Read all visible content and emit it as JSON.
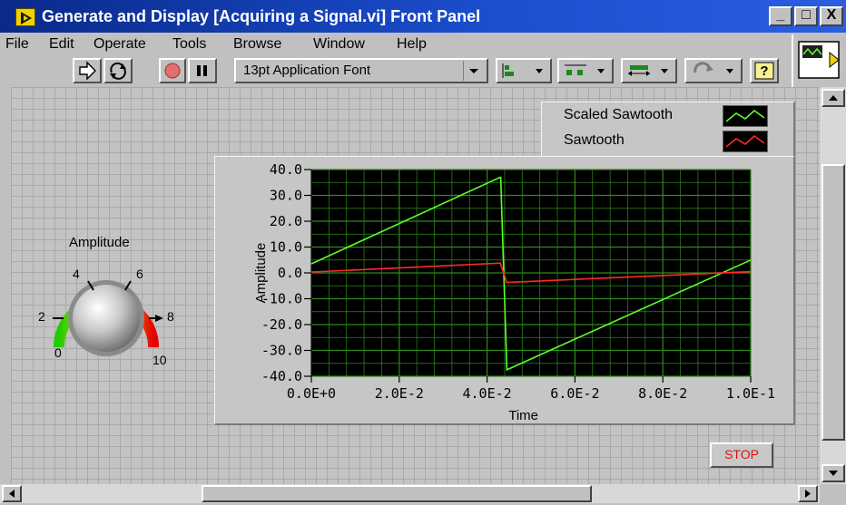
{
  "window": {
    "title": "Generate and Display [Acquiring a Signal.vi] Front Panel",
    "buttons": [
      "_",
      "□",
      "X"
    ]
  },
  "menu": [
    "File",
    "Edit",
    "Operate",
    "Tools",
    "Browse",
    "Window",
    "Help"
  ],
  "toolbar": {
    "font": "13pt Application Font",
    "help_glyph": "?"
  },
  "knob": {
    "label": "Amplitude",
    "scale": [
      "0",
      "2",
      "4",
      "6",
      "8",
      "10"
    ]
  },
  "legend": [
    {
      "name": "Scaled Sawtooth",
      "color": "#5cff2a"
    },
    {
      "name": "Sawtooth",
      "color": "#ff2a2a"
    }
  ],
  "stop_label": "STOP",
  "colors": {
    "plot_bg": "#000000",
    "grid": "#2e8a1a",
    "scaled": "#5cff2a",
    "raw": "#ff2a2a",
    "stop_text": "#e01010"
  },
  "chart_data": {
    "type": "line",
    "title": "",
    "xlabel": "Time",
    "ylabel": "Amplitude",
    "xlim": [
      0,
      0.1
    ],
    "ylim": [
      -40,
      40
    ],
    "x_ticks": [
      "0.0E+0",
      "2.0E-2",
      "4.0E-2",
      "6.0E-2",
      "8.0E-2",
      "1.0E-1"
    ],
    "y_ticks": [
      "40.0",
      "30.0",
      "20.0",
      "10.0",
      "0.0",
      "-10.0",
      "-20.0",
      "-30.0",
      "-40.0"
    ],
    "series": [
      {
        "name": "Scaled Sawtooth",
        "x": [
          0,
          0.043,
          0.0431,
          0.0445,
          0.1
        ],
        "y": [
          3.5,
          37,
          37,
          -37.5,
          5
        ]
      },
      {
        "name": "Sawtooth",
        "x": [
          0,
          0.043,
          0.0445,
          0.1
        ],
        "y": [
          0.3,
          3.8,
          -3.7,
          0.5
        ]
      }
    ]
  }
}
